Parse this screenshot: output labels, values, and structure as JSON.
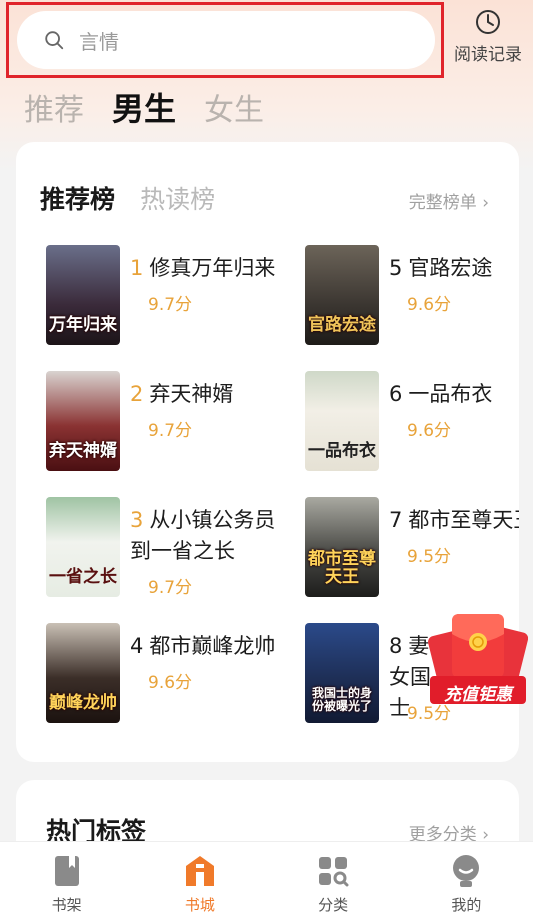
{
  "search": {
    "placeholder": "言情"
  },
  "history": {
    "label": "阅读记录"
  },
  "channels": [
    "推荐",
    "男生",
    "女生"
  ],
  "ranking": {
    "tabs": [
      "推荐榜",
      "热读榜"
    ],
    "full_list": "完整榜单 ›",
    "books": [
      {
        "rank": "1",
        "title": "修真万年归来",
        "score": "9.7分",
        "cover_text": "万年归来",
        "cover_color": "#3a2a3a"
      },
      {
        "rank": "2",
        "title": "弃天神婿",
        "score": "9.7分",
        "cover_text": "弃天神婿",
        "cover_color": "#6b1d1d"
      },
      {
        "rank": "3",
        "title": "从小镇公务员到一省之长",
        "score": "9.7分",
        "cover_text": "一省之长",
        "cover_color": "#dfe8dc"
      },
      {
        "rank": "4",
        "title": "都市巅峰龙帅",
        "score": "9.6分",
        "cover_text": "巅峰龙帅",
        "cover_color": "#2a2320"
      },
      {
        "rank": "5",
        "title": "官路宏途",
        "score": "9.6分",
        "cover_text": "官路宏途",
        "cover_color": "#3b3631"
      },
      {
        "rank": "6",
        "title": "一品布衣",
        "score": "9.6分",
        "cover_text": "一品布衣",
        "cover_color": "#e9e6dc"
      },
      {
        "rank": "7",
        "title": "都市至尊天王",
        "score": "9.5分",
        "cover_text": "都市至尊天王",
        "cover_color": "#4a4a46"
      },
      {
        "rank": "8",
        "title": "妻女国士",
        "score": "9.5分",
        "cover_text": "我国士的身份被曝光了",
        "cover_color": "#1e2f57"
      }
    ]
  },
  "tags": {
    "title": "热门标签",
    "more": "更多分类 ›"
  },
  "promo": {
    "label": "充值钜惠"
  },
  "nav": [
    {
      "label": "书架",
      "icon": "bookshelf-icon"
    },
    {
      "label": "书城",
      "icon": "bookstore-icon"
    },
    {
      "label": "分类",
      "icon": "category-icon"
    },
    {
      "label": "我的",
      "icon": "profile-icon"
    }
  ],
  "colors": {
    "accent": "#f07a2a",
    "score": "#e8a33a",
    "highlight_border": "#e0242b"
  }
}
